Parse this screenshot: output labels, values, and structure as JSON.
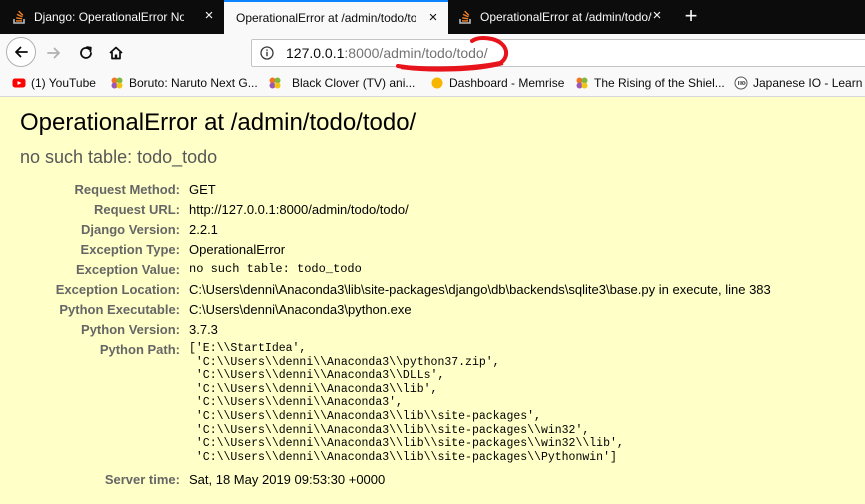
{
  "tabs": [
    {
      "title": "Django: OperationalError No Such",
      "active": false
    },
    {
      "title": "OperationalError at /admin/todo/todo/",
      "active": true
    },
    {
      "title": "OperationalError at /admin/todo/todo/",
      "active": false
    }
  ],
  "address_bar": {
    "url_host": "127.0.0.1",
    "url_rest": ":8000/admin/todo/todo/"
  },
  "bookmarks": [
    {
      "label": "(1) YouTube",
      "icon": "youtube-icon"
    },
    {
      "label": "Boruto: Naruto Next G...",
      "icon": "crunchyroll-icon"
    },
    {
      "label": "Black Clover (TV) ani...",
      "icon": "crunchyroll-icon"
    },
    {
      "label": "Dashboard - Memrise",
      "icon": "memrise-icon"
    },
    {
      "label": "The Rising of the Shiel...",
      "icon": "crunchyroll-icon"
    },
    {
      "label": "Japanese IO - Learn J",
      "icon": "jio-icon"
    }
  ],
  "error": {
    "title": "OperationalError at /admin/todo/todo/",
    "subtitle": "no such table: todo_todo"
  },
  "meta": [
    {
      "label": "Request Method:",
      "value": "GET"
    },
    {
      "label": "Request URL:",
      "value": "http://127.0.0.1:8000/admin/todo/todo/"
    },
    {
      "label": "Django Version:",
      "value": "2.2.1"
    },
    {
      "label": "Exception Type:",
      "value": "OperationalError"
    },
    {
      "label": "Exception Value:",
      "value": "no such table: todo_todo"
    },
    {
      "label": "Exception Location:",
      "value": "C:\\Users\\denni\\Anaconda3\\lib\\site-packages\\django\\db\\backends\\sqlite3\\base.py in execute, line 383"
    },
    {
      "label": "Python Executable:",
      "value": "C:\\Users\\denni\\Anaconda3\\python.exe"
    },
    {
      "label": "Python Version:",
      "value": "3.7.3"
    },
    {
      "label": "Python Path:",
      "value": "['E:\\\\StartIdea',\n 'C:\\\\Users\\\\denni\\\\Anaconda3\\\\python37.zip',\n 'C:\\\\Users\\\\denni\\\\Anaconda3\\\\DLLs',\n 'C:\\\\Users\\\\denni\\\\Anaconda3\\\\lib',\n 'C:\\\\Users\\\\denni\\\\Anaconda3',\n 'C:\\\\Users\\\\denni\\\\Anaconda3\\\\lib\\\\site-packages',\n 'C:\\\\Users\\\\denni\\\\Anaconda3\\\\lib\\\\site-packages\\\\win32',\n 'C:\\\\Users\\\\denni\\\\Anaconda3\\\\lib\\\\site-packages\\\\win32\\\\lib',\n 'C:\\\\Users\\\\denni\\\\Anaconda3\\\\lib\\\\site-packages\\\\Pythonwin']"
    },
    {
      "label": "Server time:",
      "value": "Sat, 18 May 2019 09:53:30 +0000"
    }
  ],
  "colors": {
    "page_bg": "#ffffc8",
    "tabstrip_bg": "#0c0c0d",
    "active_tab_accent": "#0a84ff",
    "annotation": "#e8141c"
  }
}
